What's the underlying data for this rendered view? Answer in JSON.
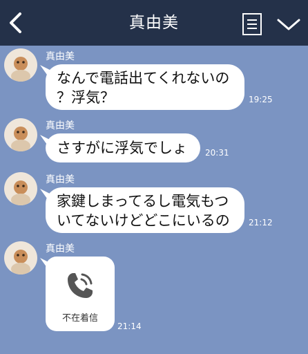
{
  "header": {
    "title": "真由美"
  },
  "messages": [
    {
      "sender": "真由美",
      "lines": [
        "なんで電話出てくれないの",
        "？浮気？"
      ],
      "time": "19:25"
    },
    {
      "sender": "真由美",
      "lines": [
        "さすがに浮気でしょ"
      ],
      "time": "20:31"
    },
    {
      "sender": "真由美",
      "lines": [
        "家鍵しまってるし電気もつ",
        "いてないけどどこにいるの"
      ],
      "time": "21:12"
    },
    {
      "sender": "真由美",
      "call": {
        "label": "不在着信",
        "icon": "phone-icon"
      },
      "time": "21:14"
    }
  ],
  "colors": {
    "header_bg": "#243149",
    "chat_bg": "#7b94c2",
    "bubble_bg": "#ffffff"
  }
}
